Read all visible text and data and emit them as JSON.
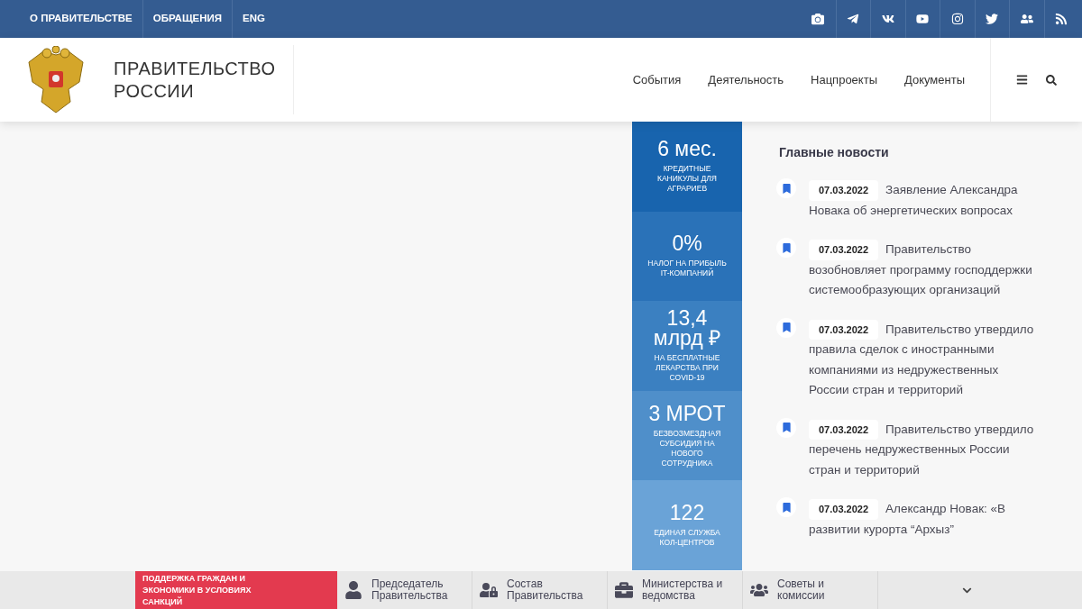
{
  "top_nav": [
    "О ПРАВИТЕЛЬСТВЕ",
    "ОБРАЩЕНИЯ",
    "ENG"
  ],
  "site_title": {
    "line1": "ПРАВИТЕЛЬСТВО",
    "line2": "РОССИИ"
  },
  "main_nav": [
    "События",
    "Деятельность",
    "Нацпроекты",
    "Документы"
  ],
  "stats": [
    {
      "value": "6 мес.",
      "caption": "КРЕДИТНЫЕ КАНИКУЛЫ ДЛЯ АГРАРИЕВ"
    },
    {
      "value": "0%",
      "caption": "НАЛОГ НА ПРИБЫЛЬ IT-КОМПАНИЙ"
    },
    {
      "value": "13,4 млрд ₽",
      "caption": "НА БЕСПЛАТНЫЕ ЛЕКАРСТВА ПРИ COVID-19"
    },
    {
      "value": "3 МРОТ",
      "caption": "БЕЗВОЗМЕЗДНАЯ СУБСИДИЯ НА НОВОГО СОТРУДНИКА"
    },
    {
      "value": "122",
      "caption": "ЕДИНАЯ СЛУЖБА КОЛ-ЦЕНТРОВ"
    }
  ],
  "news": {
    "title": "Главные новости",
    "items": [
      {
        "date": "07.03.2022",
        "headline": "Заявление Александра Новака об энергетических вопросах"
      },
      {
        "date": "07.03.2022",
        "headline": "Правительство возобновляет программу господдержки системообразующих организаций"
      },
      {
        "date": "07.03.2022",
        "headline": "Правительство утвердило правила сделок с иностранными компаниями из недружественных России стран и территорий"
      },
      {
        "date": "07.03.2022",
        "headline": "Правительство утвердило перечень недружественных России стран и территорий"
      },
      {
        "date": "07.03.2022",
        "headline": "Александр Новак: «В развитии курорта “Архыз”"
      }
    ]
  },
  "bottom_bar": {
    "banner": "ПОДДЕРЖКА ГРАЖДАН И ЭКОНОМИКИ В УСЛОВИЯХ САНКЦИЙ",
    "items": [
      "Председатель Правительства",
      "Состав Правительства",
      "Министерства и ведомства",
      "Советы и комиссии"
    ]
  }
}
